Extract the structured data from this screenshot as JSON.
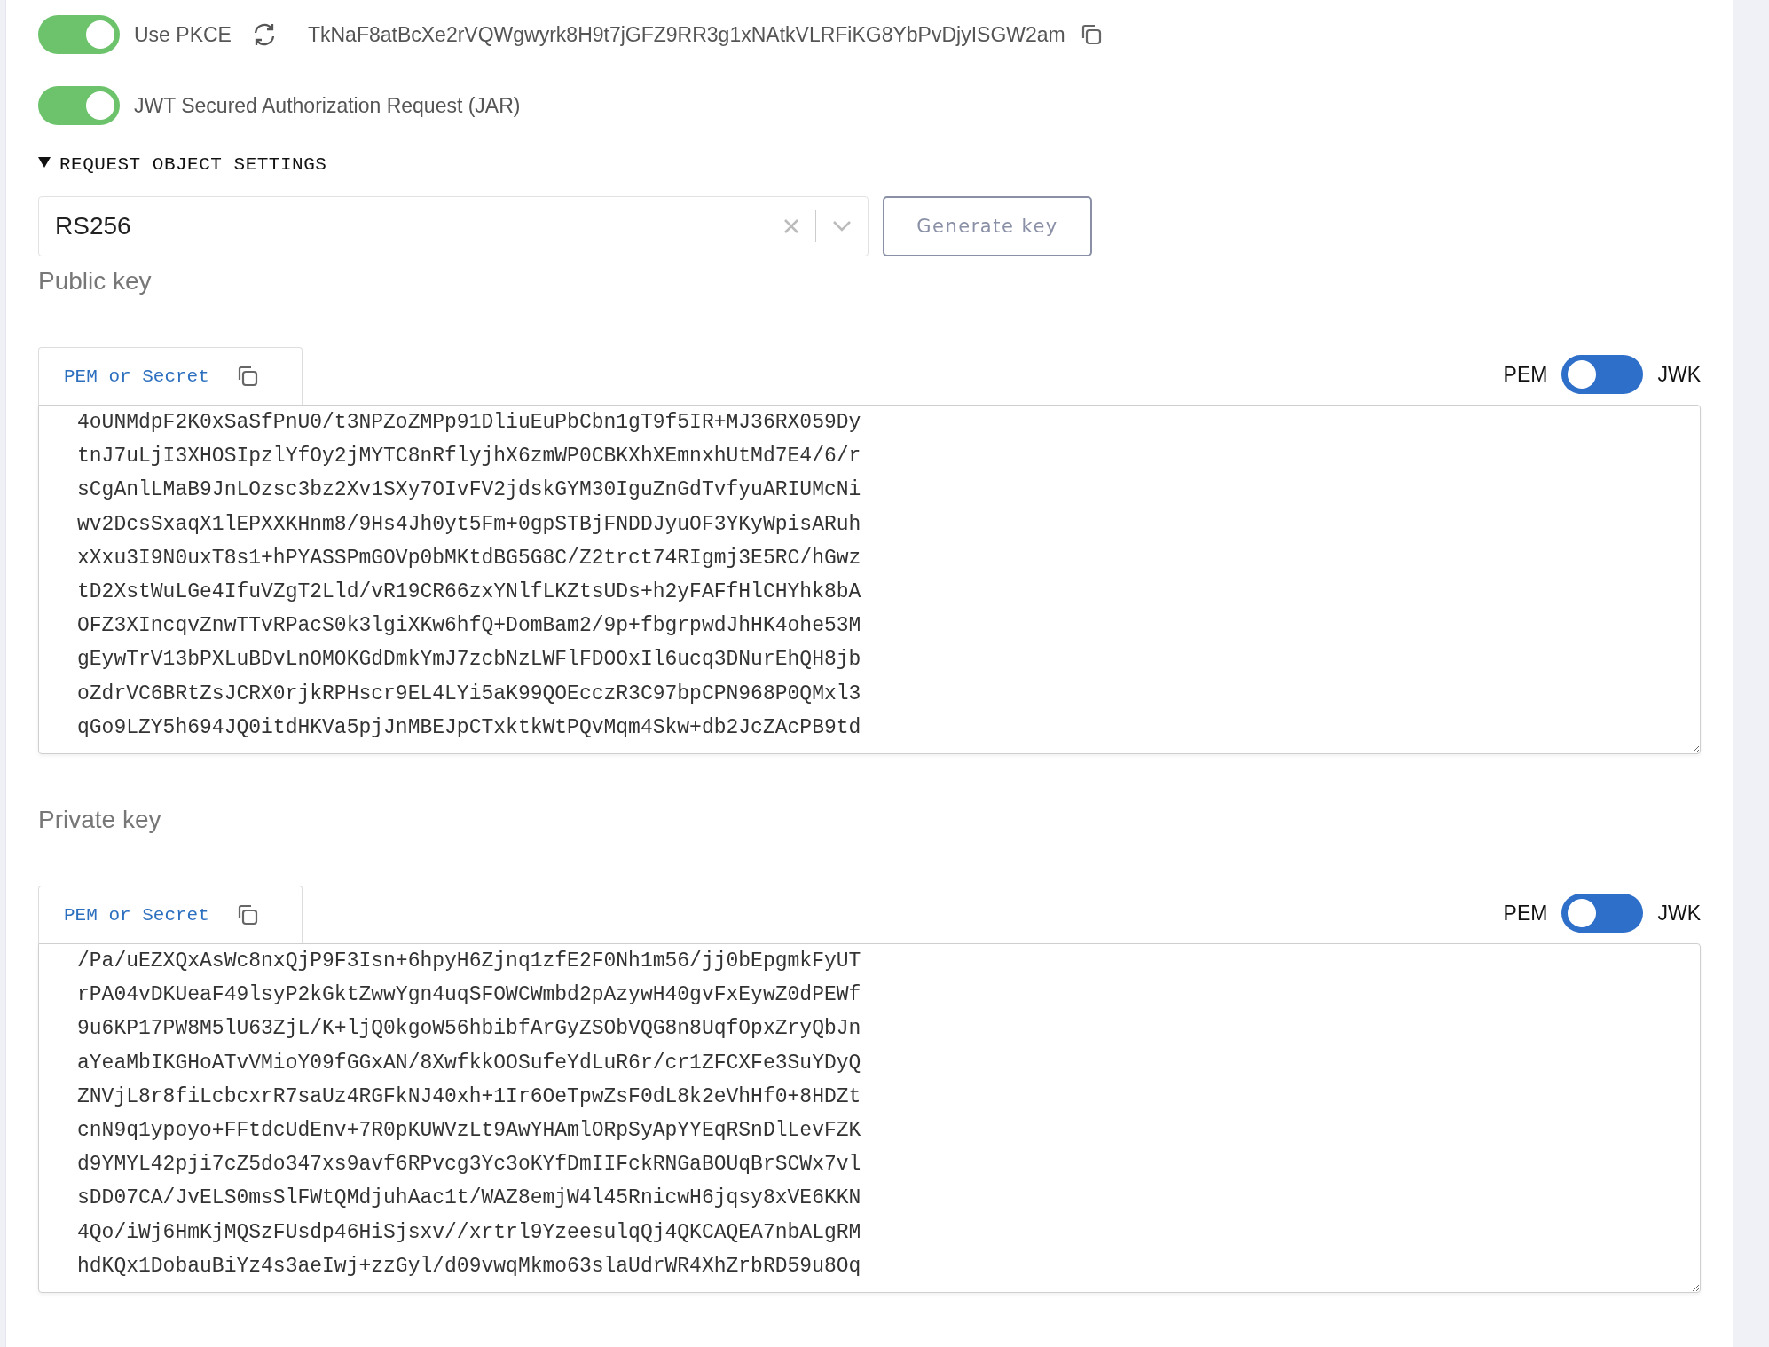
{
  "toggles": [
    {
      "label": "Use PKCE",
      "on": true,
      "value": "TkNaF8atBcXe2rVQWgwyrk8H9t7jGFZ9RR3g1xNAtkVLRFiKG8YbPvDjyISGW2am",
      "kind": "pkce"
    },
    {
      "label": "JWT Secured Authorization Request (JAR)",
      "on": true,
      "kind": "plain"
    }
  ],
  "section": {
    "label": "REQUEST OBJECT SETTINGS",
    "expanded": true
  },
  "algorithm_select": {
    "value": "RS256"
  },
  "generate_button": "Generate key",
  "keys": [
    {
      "label": "Public key",
      "tab": "PEM or Secret",
      "format_left": "PEM",
      "format_right": "JWK",
      "jwk": false,
      "lines": [
        "4oUNMdpF2K0xSaSfPnU0/t3NPZoZMPp91DliuEuPbCbn1gT9f5IR+MJ36RX059Dy",
        "tnJ7uLjI3XHOSIpzlYfOy2jMYTC8nRflyjhX6zmWP0CBKXhXEmnxhUtMd7E4/6/r",
        "sCgAnlLMaB9JnLOzsc3bz2Xv1SXy7OIvFV2jdskGYM30IguZnGdTvfyuARIUMcNi",
        "wv2DcsSxaqX1lEPXXKHnm8/9Hs4Jh0yt5Fm+0gpSTBjFNDDJyuOF3YKyWpisARuh",
        "xXxu3I9N0uxT8s1+hPYASSPmGOVp0bMKtdBG5G8C/Z2trct74RIgmj3E5RC/hGwz",
        "tD2XstWuLGe4IfuVZgT2Lld/vR19CR66zxYNlfLKZtsUDs+h2yFAFfHlCHYhk8bA",
        "OFZ3XIncqvZnwTTvRPacS0k3lgiXKw6hfQ+DomBam2/9p+fbgrpwdJhHK4ohe53M",
        "gEywTrV13bPXLuBDvLnOMOKGdDmkYmJ7zcbNzLWFlFDOOxIl6ucq3DNurEhQH8jb",
        "oZdrVC6BRtZsJCRX0rjkRPHscr9EL4LYi5aK99QOEcczR3C97bpCPN968P0QMxl3",
        "qGo9LZY5h694JQ0itdHKVa5pjJnMBEJpCTxktkWtPQvMqm4Skw+db2JcZAcPB9td"
      ]
    },
    {
      "label": "Private key",
      "tab": "PEM or Secret",
      "format_left": "PEM",
      "format_right": "JWK",
      "jwk": false,
      "lines": [
        "/Pa/uEZXQxAsWc8nxQjP9F3Isn+6hpyH6Zjnq1zfE2F0Nh1m56/jj0bEpgmkFyUT",
        "rPA04vDKUeaF49lsyP2kGktZwwYgn4uqSFOWCWmbd2pAzywH40gvFxEywZ0dPEWf",
        "9u6KP17PW8M5lU63ZjL/K+ljQ0kgoW56hbibfArGyZSObVQG8n8UqfOpxZryQbJn",
        "aYeaMbIKGHoATvVMioY09fGGxAN/8XwfkkOOSufeYdLuR6r/cr1ZFCXFe3SuYDyQ",
        "ZNVjL8r8fiLcbcxrR7saUz4RGFkNJ40xh+1Ir6OeTpwZsF0dL8k2eVhHf0+8HDZt",
        "cnN9q1ypoyo+FFtdcUdEnv+7R0pKUWVzLt9AwYHAmlORpSyApYYEqRSnDlLevFZK",
        "d9YMYL42pji7cZ5do347xs9avf6RPvcg3Yc3oKYfDmIIFckRNGaBOUqBrSCWx7vl",
        "sDD07CA/JvELS0msSlFWtQMdjuhAac1t/WAZ8emjW4l45RnicwH6jqsy8xVE6KKN",
        "4Qo/iWj6HmKjMQSzFUsdp46HiSjsxv//xrtrl9YzeesulqQj4QKCAQEA7nbALgRM",
        "hdKQx1DobauBiYz4s3aeIwj+zzGyl/d09vwqMkmo63slaUdrWR4XhZrbRD59u8Oq"
      ]
    }
  ]
}
